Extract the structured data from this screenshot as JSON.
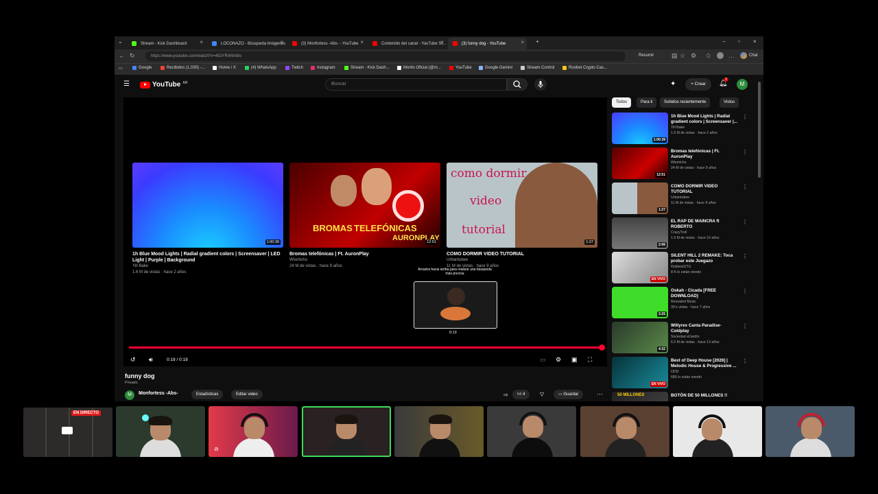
{
  "browser": {
    "tabs": [
      {
        "label": "Stream - Kick Dashboard",
        "color": "#53fc18"
      },
      {
        "label": "LOCONAZO - Búsqueda Imágenes",
        "color": "#4285f4"
      },
      {
        "label": "(3) Monfortess -Abs- - YouTube",
        "color": "#ff0000"
      },
      {
        "label": "Contenido del canal - YouTube St...",
        "color": "#ff0000"
      },
      {
        "label": "(3) funny dog - YouTube",
        "color": "#ff0000"
      }
    ],
    "url": "https://www.youtube.com/watch?v=45JYRANnt9o",
    "resumir_label": "Resumir",
    "chat_label": "Chat",
    "bookmarks": [
      "Google",
      "Recibidos (1,030) -...",
      "Home / X",
      "(4) WhatsApp",
      "Twitch",
      "Instagram",
      "Stream - Kick Dash...",
      "Monfo Oficial (@m...",
      "YouTube",
      "Google Gemini",
      "Stream Control",
      "Roobet Crypto Cas..."
    ]
  },
  "youtube": {
    "logo_text": "YouTube",
    "logo_region": "AR",
    "search_placeholder": "Buscar",
    "create_label": "Crear",
    "notification_count": "3",
    "avatar_letter": "M",
    "end_cards": [
      {
        "title": "1h Blue Mood Lights | Radial gradient colors | Screensaver | LED Light | Purple | Background",
        "channel": "Yill Bake",
        "meta": "1.6 M de vistas · hace 2 años",
        "duration": "1:00:39"
      },
      {
        "title": "Bromas telefónicas | Ft. AuronPlay",
        "channel": "Wismichu",
        "meta": "24 M de vistas · hace 9 años",
        "duration": "12:51",
        "thumb_text_1": "BROMAS",
        "thumb_text_2": "TELEFÓNICAS",
        "thumb_text_3": "AURONPLAY"
      },
      {
        "title": "COMO DORMIR VIDEO TUTORIAL",
        "channel": "Urbantubee",
        "meta": "11 M de vistas · hace 9 años",
        "duration": "1:27",
        "thumb_text_1": "como dormir",
        "thumb_text_2": "video",
        "thumb_text_3": "tutorial"
      }
    ],
    "preview_hint": "Arrastra hacia arriba para realizar una búsqueda más precisa",
    "preview_time": "0:13",
    "time_display": "0:19 / 0:19",
    "video_title": "funny dog",
    "privacy": "Privado",
    "channel_name": "Monfortess -Abs-",
    "stats_label": "Estadísticas",
    "edit_label": "Editar video",
    "like_count": "4",
    "save_label": "Guardar",
    "chips": [
      "Todos",
      "Para ti",
      "Subidos recientemente",
      "Vistos"
    ],
    "recommendations": [
      {
        "title": "1h Blue Mood Lights | Radial gradient colors | Screensaver |...",
        "channel": "Yill Bake",
        "meta": "1.6 M de vistas · hace 2 años",
        "badge": "1:00:39"
      },
      {
        "title": "Bromas telefónicas | Ft. AuronPlay",
        "channel": "Wismichu",
        "meta": "24 M de vistas · hace 9 años",
        "badge": "12:51"
      },
      {
        "title": "COMO DORMIR VIDEO TUTORIAL",
        "channel": "Urbantubee",
        "meta": "11 M de vistas · hace 9 años",
        "badge": "1:27"
      },
      {
        "title": "EL RAP DE MAINCRA ft ROBERTO",
        "channel": "CrazyTroll",
        "meta": "1.9 M de vistas · hace 10 años",
        "badge": "2:06"
      },
      {
        "title": "SILENT HILL 2 REMAKE: Toca probar este Juegazo",
        "channel": "RobleisIUTU",
        "meta": "8 K lo están viendo",
        "badge": "EN VIVO"
      },
      {
        "title": "Oskah - Cicada [FREE DOWNLOAD]",
        "channel": "Revealed Music",
        "meta": "39 k vistas · hace 7 años",
        "badge": "3:25"
      },
      {
        "title": "Willyrex Canta Paradise-Coldplay",
        "channel": "Sociedad elJardín",
        "meta": "6.2 M de vistas · hace 13 años",
        "badge": "4:32"
      },
      {
        "title": "Best of Deep House [2026] | Melodic House & Progressive ...",
        "channel": "ODD",
        "meta": "686 lo están viendo",
        "badge": "EN VIVO"
      },
      {
        "title": "BOTÓN DE 50 MILLONES !!",
        "channel": "",
        "meta": "",
        "badge": "50 MILLONES"
      }
    ]
  },
  "stream": {
    "live_label": "EN DIRECTO"
  }
}
